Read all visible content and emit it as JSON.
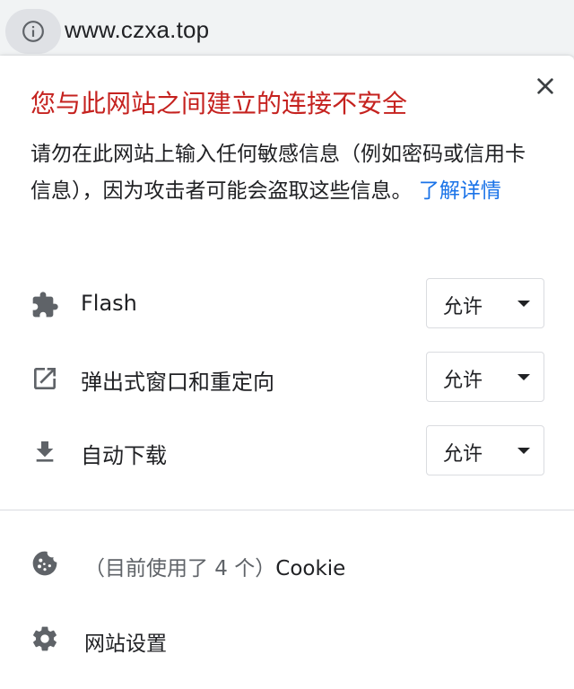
{
  "omnibox": {
    "url": "www.czxa.top",
    "info_icon": "info-icon"
  },
  "popup": {
    "title": "您与此网站之间建立的连接不安全",
    "description": "请勿在此网站上输入任何敏感信息（例如密码或信用卡信息），因为攻击者可能会盗取这些信息。",
    "learn_more": "了解详情",
    "close_icon": "close-icon"
  },
  "permissions": [
    {
      "icon": "puzzle-piece-icon",
      "label": "Flash",
      "value": "允许"
    },
    {
      "icon": "open-in-new-icon",
      "label": "弹出式窗口和重定向",
      "value": "允许"
    },
    {
      "icon": "download-icon",
      "label": "自动下载",
      "value": "允许"
    }
  ],
  "footer": {
    "cookies_count_text": "（目前使用了 4 个）",
    "cookies_label": "Cookie",
    "cookies_icon": "cookie-icon",
    "site_settings": "网站设置",
    "site_settings_icon": "gear-icon"
  },
  "colors": {
    "title_red": "#c5221f",
    "link_blue": "#1a73e8",
    "icon_gray": "#5f6368",
    "text": "#202124"
  }
}
